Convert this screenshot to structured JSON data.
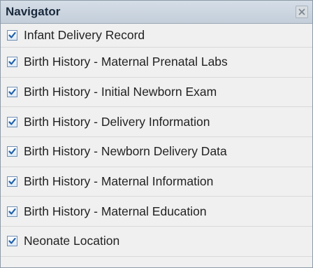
{
  "navigator": {
    "title": "Navigator",
    "close_icon": "close-icon",
    "items": [
      {
        "label": "Infant Delivery Record",
        "checked": true
      },
      {
        "label": "Birth History - Maternal Prenatal Labs",
        "checked": true
      },
      {
        "label": "Birth History - Initial Newborn Exam",
        "checked": true
      },
      {
        "label": "Birth History - Delivery Information",
        "checked": true
      },
      {
        "label": "Birth History - Newborn Delivery Data",
        "checked": true
      },
      {
        "label": "Birth History - Maternal Information",
        "checked": true
      },
      {
        "label": "Birth History - Maternal Education",
        "checked": true
      },
      {
        "label": "Neonate Location",
        "checked": true
      }
    ]
  },
  "colors": {
    "header_bg": "#c9d3de",
    "check_mark": "#1f5fa8",
    "panel_bg": "#f0f0f0"
  }
}
